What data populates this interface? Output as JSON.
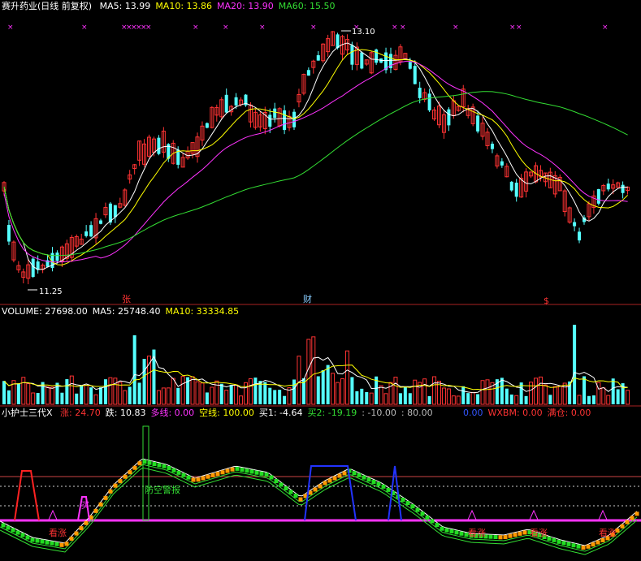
{
  "main_panel": {
    "title": "赛升药业(日线 前复权)",
    "ma": [
      {
        "label": "MA5: 13.99",
        "color": "#ffffff"
      },
      {
        "label": "MA10: 13.86",
        "color": "#ffff00"
      },
      {
        "label": "MA20: 13.90",
        "color": "#ff33ff"
      },
      {
        "label": "MA60: 15.50",
        "color": "#33dd33"
      }
    ],
    "high_label": "13.10",
    "low_label": "11.25",
    "markers": [
      {
        "text": "张",
        "color": "#ff3333"
      },
      {
        "text": "财",
        "color": "#88ccff"
      },
      {
        "text": "$",
        "color": "#ff3333"
      }
    ],
    "colors": {
      "up": "#ff3333",
      "down": "#55ffff"
    }
  },
  "volume_panel": {
    "labels": [
      {
        "label": "VOLUME: 27698.00",
        "color": "#ffffff"
      },
      {
        "label": "MA5: 25748.40",
        "color": "#ffffff"
      },
      {
        "label": "MA10: 33334.85",
        "color": "#ffff00"
      }
    ]
  },
  "indicator_panel": {
    "name": "小护士三代X",
    "labels": [
      {
        "label": "涨: 24.70",
        "color": "#ff3333"
      },
      {
        "label": "跌: 10.83",
        "color": "#ffffff"
      },
      {
        "label": "多线: 0.00",
        "color": "#ff33ff"
      },
      {
        "label": "空线: 100.00",
        "color": "#ffff00"
      },
      {
        "label": "买1: -4.64",
        "color": "#ffffff"
      },
      {
        "label": "买2: -19.19",
        "color": "#33dd33"
      },
      {
        "label": ": -10.00",
        "color": "#bbbbbb"
      },
      {
        "label": ": 80.00",
        "color": "#bbbbbb"
      }
    ],
    "right_labels": [
      {
        "label": "0.00",
        "color": "#3355ff"
      },
      {
        "label": "WXBM: 0.00",
        "color": "#ff3333"
      },
      {
        "label": "满仓: 0.00",
        "color": "#ff3333"
      }
    ],
    "annotations": {
      "signal": "防空警报",
      "look_up": "看涨",
      "tag": "买"
    }
  }
}
